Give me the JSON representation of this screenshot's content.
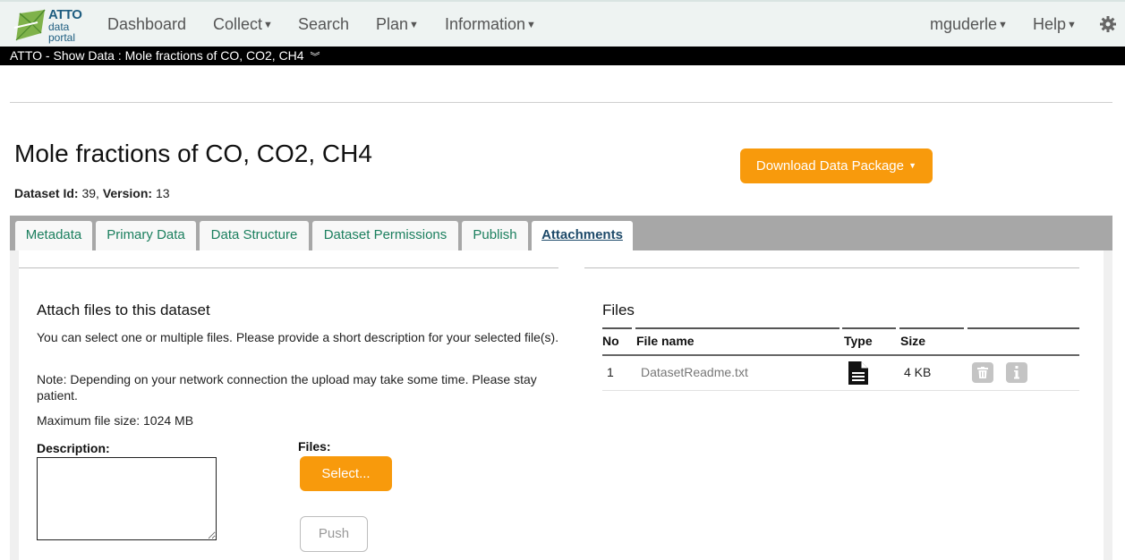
{
  "nav": {
    "logo": {
      "brand": "ATTO",
      "line1": "data",
      "line2": "portal"
    },
    "items": [
      {
        "label": "Dashboard",
        "caret": false
      },
      {
        "label": "Collect",
        "caret": true
      },
      {
        "label": "Search",
        "caret": false
      },
      {
        "label": "Plan",
        "caret": true
      },
      {
        "label": "Information",
        "caret": true
      }
    ],
    "user": "mguderle",
    "help": "Help",
    "settings_icon": "gear-icon"
  },
  "breadcrumb": "ATTO - Show Data : Mole fractions of CO, CO2, CH4",
  "page": {
    "title": "Mole fractions of CO, CO2, CH4",
    "dataset_id_label": "Dataset Id:",
    "dataset_id": "39",
    "version_label": "Version:",
    "version": "13",
    "download_button": "Download Data Package"
  },
  "tabs": [
    {
      "label": "Metadata",
      "active": false
    },
    {
      "label": "Primary Data",
      "active": false
    },
    {
      "label": "Data Structure",
      "active": false
    },
    {
      "label": "Dataset Permissions",
      "active": false
    },
    {
      "label": "Publish",
      "active": false
    },
    {
      "label": "Attachments",
      "active": true
    }
  ],
  "attach": {
    "heading": "Attach files to this dataset",
    "text1": "You can select one or multiple files. Please provide a short description for your selected file(s).",
    "text2": "Note: Depending on your network connection the upload may take some time. Please stay patient.",
    "max_size": "Maximum file size: 1024 MB",
    "description_label": "Description:",
    "description_value": "",
    "files_label": "Files:",
    "select_button": "Select...",
    "push_button": "Push"
  },
  "files": {
    "heading": "Files",
    "columns": [
      "No",
      "File name",
      "Type",
      "Size"
    ],
    "rows": [
      {
        "no": "1",
        "name": "DatasetReadme.txt",
        "type_icon": "file-text-icon",
        "size": "4 KB"
      }
    ],
    "row_action_icons": [
      "trash-icon",
      "info-icon"
    ]
  }
}
